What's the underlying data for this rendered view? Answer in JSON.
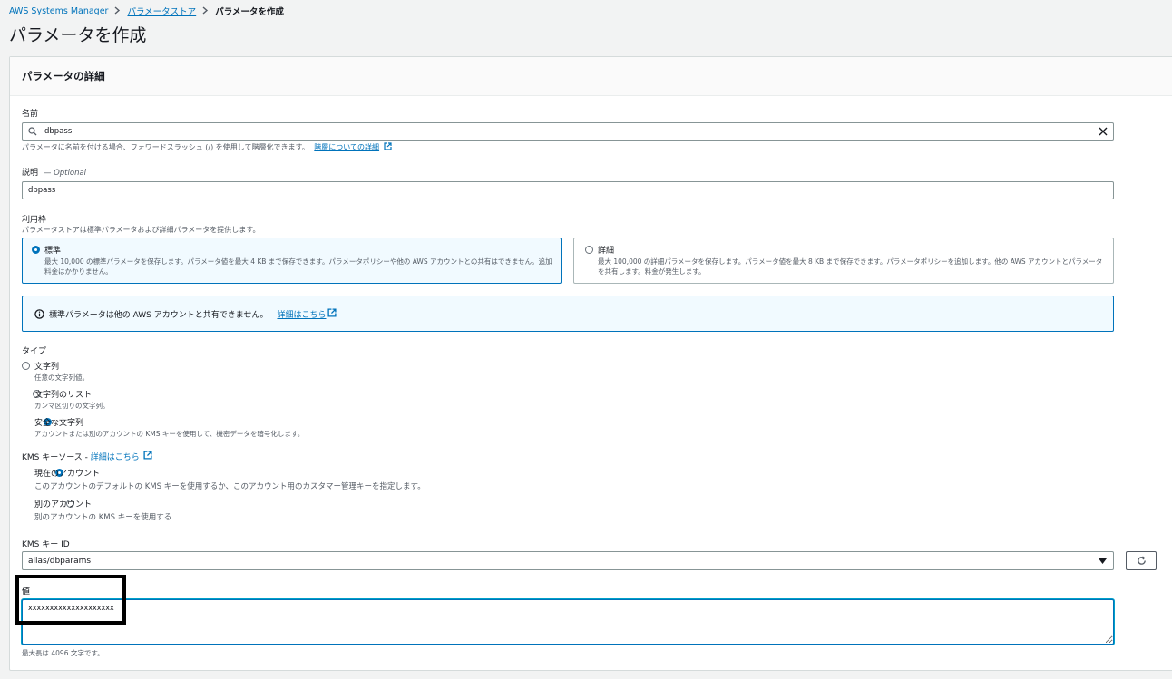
{
  "breadcrumb": {
    "items": [
      "AWS Systems Manager",
      "パラメータストア"
    ],
    "current": "パラメータを作成"
  },
  "page": {
    "title": "パラメータを作成"
  },
  "panel": {
    "title": "パラメータの詳細"
  },
  "name_field": {
    "label": "名前",
    "value": "dbpass",
    "hint": "パラメータに名前を付ける場合、フォワードスラッシュ (/) を使用して階層化できます。",
    "hint_link": "階層についての詳細"
  },
  "description_field": {
    "label": "説明",
    "optional": "— Optional",
    "value": "dbpass"
  },
  "tier": {
    "label": "利用枠",
    "desc": "パラメータストアは標準パラメータおよび詳細パラメータを提供します。",
    "options": [
      {
        "title": "標準",
        "desc": "最大 10,000 の標準パラメータを保存します。パラメータ値を最大 4 KB まで保存できます。パラメータポリシーや他の AWS アカウントとの共有はできません。追加料金はかかりません。",
        "selected": true
      },
      {
        "title": "詳細",
        "desc": "最大 100,000 の詳細パラメータを保存します。パラメータ値を最大 8 KB まで保存できます。パラメータポリシーを追加します。他の AWS アカウントとパラメータを共有します。料金が発生します。",
        "selected": false
      }
    ]
  },
  "info": {
    "text": "標準パラメータは他の AWS アカウントと共有できません。",
    "link": "詳細はこちら"
  },
  "type": {
    "label": "タイプ",
    "options": [
      {
        "title": "文字列",
        "desc": "任意の文字列値。",
        "selected": false
      },
      {
        "title": "文字列のリスト",
        "desc": "カンマ区切りの文字列。",
        "selected": false
      },
      {
        "title": "安全な文字列",
        "desc": "アカウントまたは別のアカウントの KMS キーを使用して、機密データを暗号化します。",
        "selected": true
      }
    ]
  },
  "kms_source": {
    "label": "KMS キーソース - ",
    "link": "詳細はこちら",
    "options": [
      {
        "title": "現在のアカウント",
        "desc": "このアカウントのデフォルトの KMS キーを使用するか、このアカウント用のカスタマー管理キーを指定します。",
        "selected": true
      },
      {
        "title": "別のアカウント",
        "desc": "別のアカウントの KMS キーを使用する",
        "selected": false
      }
    ]
  },
  "kms_key_id": {
    "label": "KMS キー ID",
    "value": "alias/dbparams"
  },
  "value_field": {
    "label": "値",
    "value": "xxxxxxxxxxxxxxxxxxxx",
    "hint": "最大長は 4096 文字です。"
  },
  "colors": {
    "accent": "#0073bb",
    "border": "#879596",
    "background": "#f2f3f3",
    "info_bg": "#f1faff"
  }
}
